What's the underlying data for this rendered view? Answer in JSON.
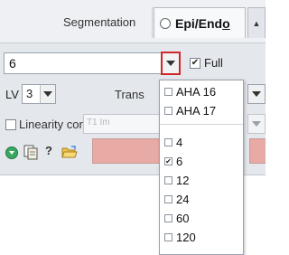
{
  "header": {
    "segmentation_label": "Segmentation",
    "active_tab_label": "Epi/Endo",
    "active_tab_label_prefix": "Epi/End",
    "active_tab_label_underlined": "o"
  },
  "controls": {
    "value_combo": "6",
    "full_checkbox_label": "Full",
    "full_checked": true,
    "lv_label": "LV",
    "lv_value": "3",
    "transform_label": "Trans",
    "linearity_label": "Linearity corr.:",
    "linearity_checked": false,
    "t1_combo_text": "T1 Im"
  },
  "toolbar": {
    "help_glyph": "?"
  },
  "popup": {
    "aha_items": [
      {
        "label": "AHA 16",
        "checked": false
      },
      {
        "label": "AHA 17",
        "checked": false
      }
    ],
    "segment_items": [
      {
        "label": "4",
        "checked": false
      },
      {
        "label": "6",
        "checked": true
      },
      {
        "label": "12",
        "checked": false
      },
      {
        "label": "24",
        "checked": false
      },
      {
        "label": "60",
        "checked": false
      },
      {
        "label": "120",
        "checked": false
      }
    ]
  },
  "colors": {
    "highlight_border": "#d22727",
    "pink_field": "#e8aaa5",
    "panel_bg": "#e4e7ec"
  }
}
